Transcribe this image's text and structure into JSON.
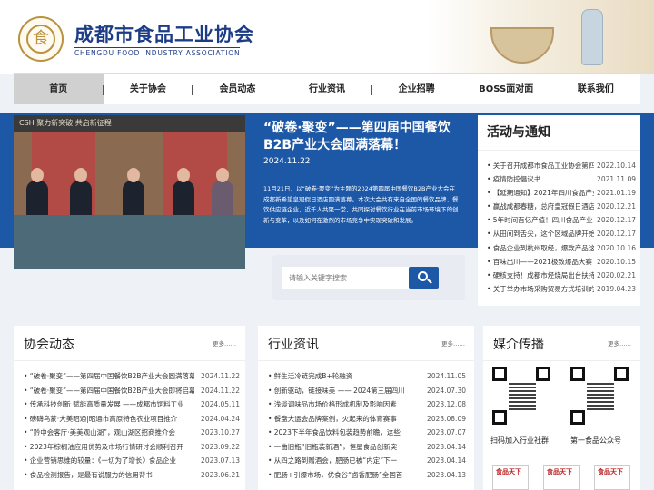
{
  "header": {
    "logo_char": "食",
    "title": "成都市食品工业协会",
    "subtitle": "CHENGDU FOOD INDUSTRY ASSOCIATION"
  },
  "nav": [
    {
      "label": "首页",
      "active": true
    },
    {
      "label": "关于协会"
    },
    {
      "label": "会员动态"
    },
    {
      "label": "行业资讯"
    },
    {
      "label": "企业招聘"
    },
    {
      "label": "BOSS面对面"
    },
    {
      "label": "联系我们"
    }
  ],
  "feature": {
    "photo_banner": "CSH  聚力新突破  共启新征程",
    "title": "“破卷·聚变”——第四届中国餐饮B2B产业大会圆满落幕！",
    "date": "2024.11.22",
    "body": "11月21日，以“破卷·聚变”为主题的2024第四届中国餐饮B2B产业大会在成都新希望皇冠假日酒店圆满落幕。本次大会共有来自全国的餐饮品牌、餐饮供应链企业，近千人共聚一堂，共同探讨餐饮行业在当前市场环境下的创新与变革，以及如何在激烈的市场竞争中实现突破和发展。"
  },
  "search": {
    "placeholder": "请输入关键字搜索"
  },
  "notices": {
    "title": "活动与通知",
    "items": [
      {
        "title": "• 关于召开成都市食品工业协会第四届会员代表大会的通知",
        "date": "2022.10.14"
      },
      {
        "title": "• 疫情防控倡议书",
        "date": "2021.11.09"
      },
      {
        "title": "• 【延期通知】2021年四川食品产业发展大会",
        "date": "2021.01.19"
      },
      {
        "title": "• 赢战成都春糖，总府皇冠假日酒店等你来",
        "date": "2020.12.21"
      },
      {
        "title": "• 5年时间百亿产值！四川食品产业",
        "date": "2020.12.17"
      },
      {
        "title": "• 从田间到舌尖，这个区域品牌开始发力",
        "date": "2020.12.17"
      },
      {
        "title": "• 食品企业到杭州取经，爆款产品这样打造",
        "date": "2020.10.16"
      },
      {
        "title": "• 百味出川——2021极致爆品大赛",
        "date": "2020.10.15"
      },
      {
        "title": "• 硬核支持！成都市烃烧局出台扶持政策",
        "date": "2020.02.21"
      },
      {
        "title": "• 关于举办市场采购贸易方式培训的通知",
        "date": "2019.04.23"
      }
    ]
  },
  "association_news": {
    "title": "协会动态",
    "more": "更多……",
    "items": [
      {
        "title": "• “破卷·聚变”——第四届中国餐饮B2B产业大会圆满落幕",
        "date": "2024.11.22"
      },
      {
        "title": "• “破卷·聚变”——第四届中国餐饮B2B产业大会即将启幕",
        "date": "2024.11.22"
      },
      {
        "title": "• 传承科技创新 赋能高质量发展 ——成都市饲料工业",
        "date": "2024.05.11"
      },
      {
        "title": "• 磅礴乌蒙·大美昭通|昭通市高原特色农业项目推介",
        "date": "2024.04.24"
      },
      {
        "title": "• “黔中会客厅·美美观山湖”，观山湖区招商推介会",
        "date": "2023.10.27"
      },
      {
        "title": "• 2023年棕榈油应用优势及市场行情研讨会顺利召开",
        "date": "2023.09.22"
      },
      {
        "title": "• 企业营销思维的较量：《一切为了增长》食品企业",
        "date": "2023.07.13"
      },
      {
        "title": "• 食品检测报告，是最有说服力的信用背书",
        "date": "2023.06.21"
      }
    ]
  },
  "industry_news": {
    "title": "行业资讯",
    "more": "更多……",
    "items": [
      {
        "title": "• 鲜生活冷链完成B+轮融资",
        "date": "2024.11.05"
      },
      {
        "title": "• 创新驱动，链接味美 —— 2024第三届四川",
        "date": "2024.07.30"
      },
      {
        "title": "• 浅谈调味品市场价格形成机制及影响因素",
        "date": "2023.12.08"
      },
      {
        "title": "• 餐盘大运会品牌案例，火起来的体育赛事",
        "date": "2023.08.09"
      },
      {
        "title": "• 2023下半年食品饮料包装趋势前瞻，这些",
        "date": "2023.07.07"
      },
      {
        "title": "• 一曲旧瓶“旧瓶装新酒”，恒星食品创新突",
        "date": "2023.04.14"
      },
      {
        "title": "• 从四之路到赠酒会，肥肠已被“内定”下一",
        "date": "2023.04.14"
      },
      {
        "title": "• 肥肠+引爆市场，优食谷“卤香肥肠”全国首",
        "date": "2023.04.13"
      }
    ]
  },
  "media": {
    "title": "媒介传播",
    "more": "更多……",
    "qr1_label": "扫码加入行业社群",
    "qr2_label": "第一食品公众号",
    "mag_label": "食品天下"
  },
  "colors": {
    "brand_blue": "#1d58a7",
    "title_blue": "#1c3c86",
    "logo_gold": "#b8923f"
  }
}
